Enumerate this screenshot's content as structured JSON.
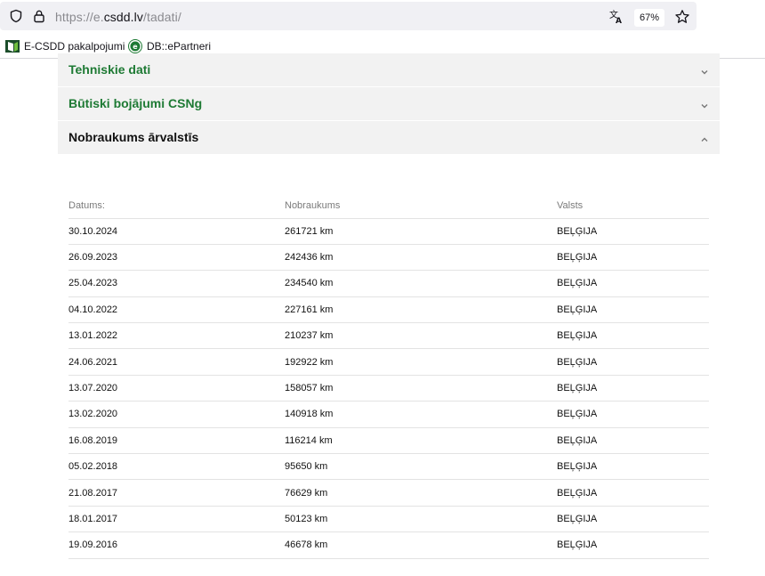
{
  "browser": {
    "url_prefix": "https://e.",
    "url_host": "csdd.lv",
    "url_path": "/tadati/",
    "zoom": "67%",
    "bookmarks": [
      {
        "label": "E-CSDD pakalpojumi"
      },
      {
        "label": "DB::ePartneri"
      }
    ]
  },
  "accordion": {
    "sections": [
      {
        "title": "Tehniskie dati",
        "expanded": false
      },
      {
        "title": "Būtiski bojājumi CSNg",
        "expanded": false
      },
      {
        "title": "Nobraukums ārvalstīs",
        "expanded": true
      }
    ]
  },
  "mileage_table": {
    "headers": [
      "Datums:",
      "Nobraukums",
      "Valsts"
    ],
    "rows": [
      [
        "30.10.2024",
        "261721 km",
        "BEĻĢIJA"
      ],
      [
        "26.09.2023",
        "242436 km",
        "BEĻĢIJA"
      ],
      [
        "25.04.2023",
        "234540 km",
        "BEĻĢIJA"
      ],
      [
        "04.10.2022",
        "227161 km",
        "BEĻĢIJA"
      ],
      [
        "13.01.2022",
        "210237 km",
        "BEĻĢIJA"
      ],
      [
        "24.06.2021",
        "192922 km",
        "BEĻĢIJA"
      ],
      [
        "13.07.2020",
        "158057 km",
        "BEĻĢIJA"
      ],
      [
        "13.02.2020",
        "140918 km",
        "BEĻĢIJA"
      ],
      [
        "16.08.2019",
        "116214 km",
        "BEĻĢIJA"
      ],
      [
        "05.02.2018",
        "95650 km",
        "BEĻĢIJA"
      ],
      [
        "21.08.2017",
        "76629 km",
        "BEĻĢIJA"
      ],
      [
        "18.01.2017",
        "50123 km",
        "BEĻĢIJA"
      ],
      [
        "19.09.2016",
        "46678 km",
        "BEĻĢIJA"
      ]
    ]
  },
  "colors": {
    "accent_green": "#1e7a34",
    "section_bg": "#f2f2f2"
  }
}
